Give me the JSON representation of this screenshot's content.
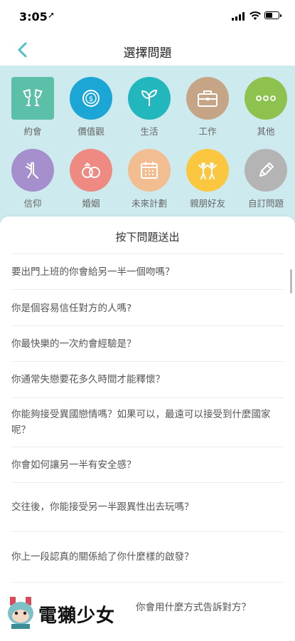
{
  "status_bar": {
    "time": "3:05",
    "location_arrow": "➚"
  },
  "nav": {
    "title": "選擇問題"
  },
  "categories": [
    {
      "label": "約會",
      "icon": "cheers-icon",
      "color": "#5cc0a8"
    },
    {
      "label": "價值觀",
      "icon": "coin-icon",
      "color": "#1ca6d6"
    },
    {
      "label": "生活",
      "icon": "sprout-icon",
      "color": "#21b7bd"
    },
    {
      "label": "工作",
      "icon": "briefcase-icon",
      "color": "#c5a585"
    },
    {
      "label": "其他",
      "icon": "more-icon",
      "color": "#8dc24e"
    },
    {
      "label": "信仰",
      "icon": "praying-hands-icon",
      "color": "#a58fcc"
    },
    {
      "label": "婚姻",
      "icon": "rings-icon",
      "color": "#ef8a83"
    },
    {
      "label": "未來計劃",
      "icon": "calendar-icon",
      "color": "#f1bd91"
    },
    {
      "label": "親朋好友",
      "icon": "friends-icon",
      "color": "#fbc741"
    },
    {
      "label": "自訂問題",
      "icon": "pencil-icon",
      "color": "#b4b4b4"
    }
  ],
  "sheet": {
    "title": "按下問題送出",
    "questions": [
      "要出門上班的你會給另一半一個吻嗎？",
      "你是個容易信任對方的人嗎?",
      "你最快樂的一次約會經驗是？",
      "你通常失戀要花多久時間才能釋懷？",
      "你能夠接受異國戀情嗎？如果可以，最遠可以接受到什麼國家呢？",
      "你會如何讓另一半有安全感？",
      "交往後，你能接受另一半跟異性出去玩嗎？",
      "你上一段認真的關係給了你什麼樣的啟發？",
      "你會用什麼方式告訴對方？"
    ]
  },
  "watermark": {
    "text": "電獺少女"
  }
}
